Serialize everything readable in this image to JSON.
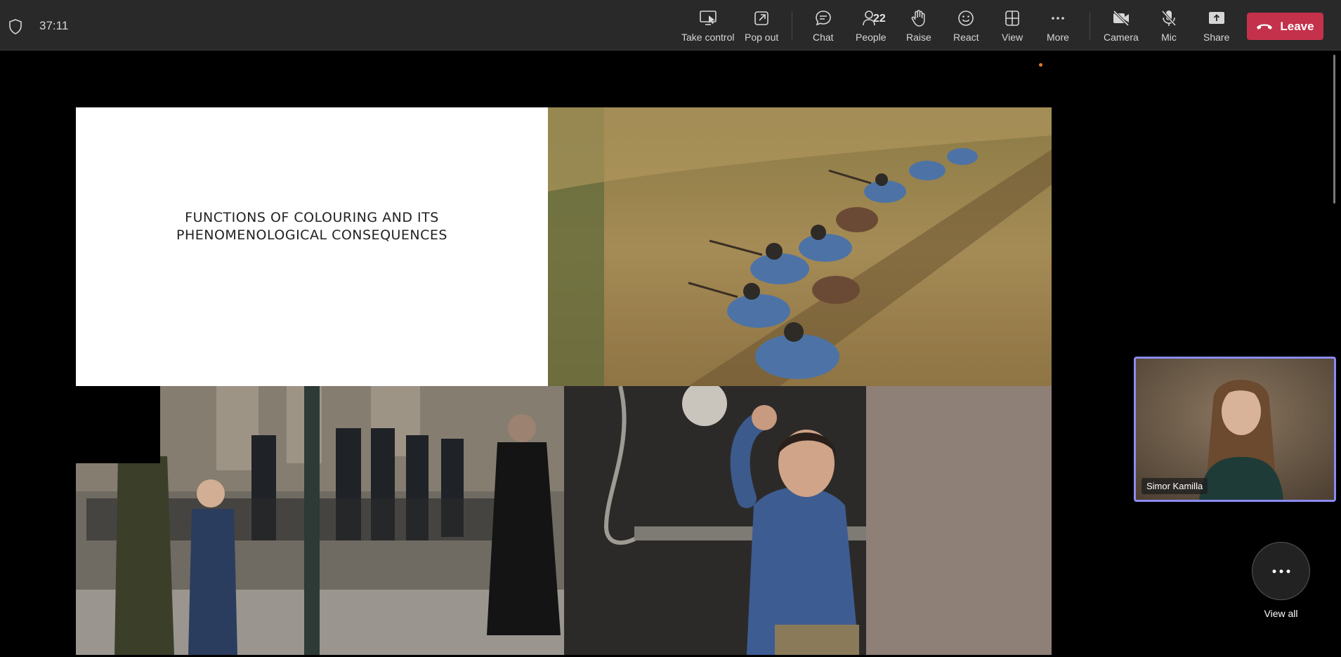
{
  "meeting": {
    "elapsed": "37:11"
  },
  "toolbar": {
    "take_control": "Take control",
    "pop_out": "Pop out",
    "chat": "Chat",
    "people": "People",
    "people_count": "22",
    "raise": "Raise",
    "react": "React",
    "view": "View",
    "more": "More",
    "camera": "Camera",
    "mic": "Mic",
    "share": "Share",
    "leave": "Leave",
    "leave_color": "#c4314b"
  },
  "slide": {
    "title_line1": "FUNCTIONS OF COLOURING AND ITS",
    "title_line2": "PHENOMENOLOGICAL CONSEQUENCES",
    "photos": [
      "soldiers-in-field-photo",
      "street-crowd-photo",
      "boy-waving-photo"
    ]
  },
  "participants": [
    {
      "name": "Simor Kamilla",
      "highlight": "#8b8bf0"
    }
  ],
  "view_all": {
    "label": "View all"
  }
}
